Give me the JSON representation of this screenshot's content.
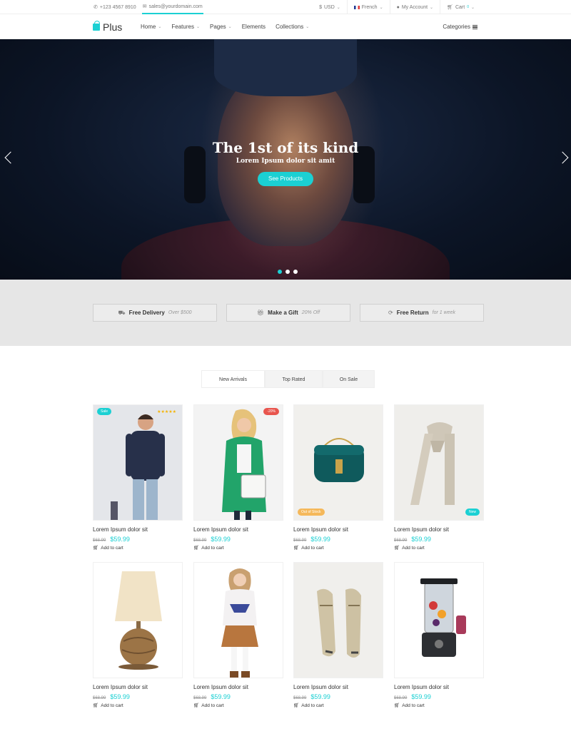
{
  "topbar": {
    "phone": "+123 4567 8910",
    "email": "sales@yourdomain.com",
    "currency": "USD",
    "language": "French",
    "account": "My Account",
    "cart": "Cart",
    "cart_count": "0"
  },
  "nav": {
    "logo": "Plus",
    "menu": [
      "Home",
      "Features",
      "Pages",
      "Elements",
      "Collections"
    ],
    "categories": "Categories"
  },
  "hero": {
    "title": "The 1st of its kind",
    "subtitle": "Lorem Ipsum dolor sit amit",
    "button": "See Products",
    "slide_count": 3,
    "active_slide": 1
  },
  "features": [
    {
      "title": "Free Delivery",
      "sub": "Over $500",
      "icon": "truck-icon"
    },
    {
      "title": "Make a Gift",
      "sub": "20% Off",
      "icon": "gift-icon"
    },
    {
      "title": "Free Return",
      "sub": "for 1 week",
      "icon": "refresh-icon"
    }
  ],
  "tabs": [
    "New Arrivals",
    "Top Rated",
    "On Sale"
  ],
  "products": [
    {
      "name": "Lorem Ipsum dolor sit",
      "old": "$68.99",
      "price": "$59.99",
      "cta": "Add to cart",
      "badge": "Sale",
      "stars": "★★★★★"
    },
    {
      "name": "Lorem Ipsum dolor sit",
      "old": "$68.99",
      "price": "$59.99",
      "cta": "Add to cart",
      "badge": "-20%"
    },
    {
      "name": "Lorem Ipsum dolor sit",
      "old": "$68.99",
      "price": "$59.99",
      "cta": "Add to cart",
      "badge": "Out of Stock"
    },
    {
      "name": "Lorem Ipsum dolor sit",
      "old": "$68.99",
      "price": "$59.99",
      "cta": "Add to cart",
      "badge": "New"
    },
    {
      "name": "Lorem Ipsum dolor sit",
      "old": "$68.99",
      "price": "$59.99",
      "cta": "Add to cart"
    },
    {
      "name": "Lorem Ipsum dolor sit",
      "old": "$68.99",
      "price": "$59.99",
      "cta": "Add to cart"
    },
    {
      "name": "Lorem Ipsum dolor sit",
      "old": "$68.99",
      "price": "$59.99",
      "cta": "Add to cart"
    },
    {
      "name": "Lorem Ipsum dolor sit",
      "old": "$68.99",
      "price": "$59.99",
      "cta": "Add to cart"
    }
  ],
  "colors": {
    "accent": "#1bd0d3",
    "sale": "#1bd0d3",
    "discount": "#e8554e",
    "out_of_stock": "#f5b85a",
    "new": "#1bd0d3"
  }
}
